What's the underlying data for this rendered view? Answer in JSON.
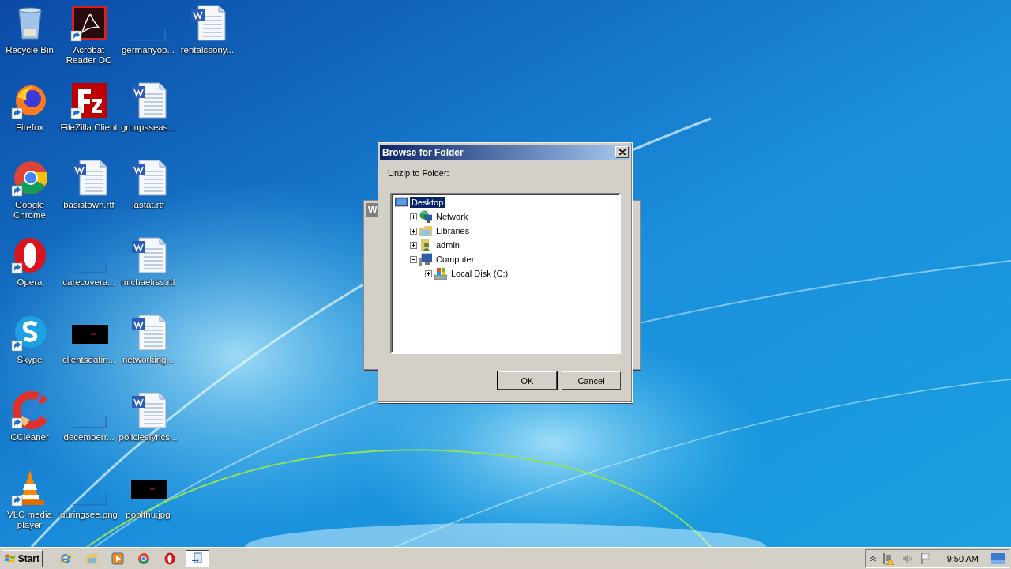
{
  "desktop": {
    "icons": [
      {
        "label": "Recycle Bin",
        "kind": "recycle",
        "shortcut": false
      },
      {
        "label": "Firefox",
        "kind": "firefox",
        "shortcut": true
      },
      {
        "label": "Google Chrome",
        "kind": "chrome",
        "shortcut": true
      },
      {
        "label": "Opera",
        "kind": "opera",
        "shortcut": true
      },
      {
        "label": "Skype",
        "kind": "skype",
        "shortcut": true
      },
      {
        "label": "CCleaner",
        "kind": "ccleaner",
        "shortcut": true
      },
      {
        "label": "VLC media player",
        "kind": "vlc",
        "shortcut": true
      },
      {
        "label": "Acrobat Reader DC",
        "kind": "acrobat",
        "shortcut": true
      },
      {
        "label": "FileZilla Client",
        "kind": "filezilla",
        "shortcut": true
      },
      {
        "label": "basistown.rtf",
        "kind": "word",
        "shortcut": false
      },
      {
        "label": "carecovera...",
        "kind": "blank",
        "shortcut": false
      },
      {
        "label": "clientsdatin...",
        "kind": "black",
        "shortcut": false
      },
      {
        "label": "decemberr...",
        "kind": "blank",
        "shortcut": false
      },
      {
        "label": "duringsee.png",
        "kind": "blank",
        "shortcut": false
      },
      {
        "label": "germanyop...",
        "kind": "blank",
        "shortcut": false
      },
      {
        "label": "groupsseas...",
        "kind": "word",
        "shortcut": false
      },
      {
        "label": "lastat.rtf",
        "kind": "word",
        "shortcut": false
      },
      {
        "label": "michaelrss.rtf",
        "kind": "word",
        "shortcut": false
      },
      {
        "label": "networking...",
        "kind": "word",
        "shortcut": false
      },
      {
        "label": "policieslyrics...",
        "kind": "word",
        "shortcut": false
      },
      {
        "label": "poolthu.jpg",
        "kind": "black",
        "shortcut": false
      },
      {
        "label": "rentalssony...",
        "kind": "word",
        "shortcut": false
      }
    ]
  },
  "background_window": {
    "title": "W"
  },
  "dialog": {
    "title": "Browse for Folder",
    "prompt": "Unzip to Folder:",
    "tree": [
      {
        "label": "Desktop",
        "kind": "desktop",
        "selected": true,
        "children": [
          {
            "label": "Network",
            "kind": "network",
            "selected": false,
            "expanded": false
          },
          {
            "label": "Libraries",
            "kind": "libraries",
            "selected": false,
            "expanded": false
          },
          {
            "label": "admin",
            "kind": "user",
            "selected": false,
            "expanded": false
          },
          {
            "label": "Computer",
            "kind": "computer",
            "selected": false,
            "expanded": true,
            "children": [
              {
                "label": "Local Disk (C:)",
                "kind": "disk",
                "selected": false,
                "expanded": false
              }
            ]
          }
        ]
      }
    ],
    "buttons": [
      {
        "label": "OK",
        "default": true
      },
      {
        "label": "Cancel",
        "default": false
      }
    ]
  },
  "taskbar": {
    "start": "Start",
    "pinned": [
      {
        "kind": "ie",
        "active": false
      },
      {
        "kind": "explorer",
        "active": false
      },
      {
        "kind": "media",
        "active": false
      },
      {
        "kind": "chrome",
        "active": false
      },
      {
        "kind": "opera",
        "active": false
      },
      {
        "kind": "window",
        "active": true
      }
    ],
    "time": "9:50 AM"
  }
}
